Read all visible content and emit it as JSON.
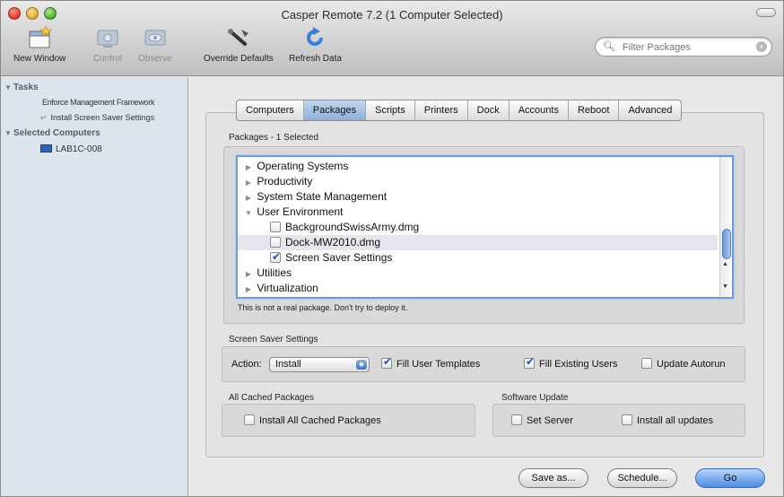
{
  "window": {
    "title": "Casper Remote 7.2  (1 Computer Selected)"
  },
  "toolbar": {
    "new_window": "New Window",
    "control": "Control",
    "observe": "Observe",
    "override_defaults": "Override Defaults",
    "refresh_data": "Refresh Data",
    "filter_placeholder": "Filter Packages"
  },
  "sidebar": {
    "tasks_heading": "Tasks",
    "tasks": [
      "Enforce Management Framework",
      "Install Screen Saver Settings"
    ],
    "computers_heading": "Selected Computers",
    "computers": [
      "LAB1C-008"
    ]
  },
  "tabs": [
    "Computers",
    "Packages",
    "Scripts",
    "Printers",
    "Dock",
    "Accounts",
    "Reboot",
    "Advanced"
  ],
  "packages": {
    "heading": "Packages - 1 Selected",
    "items": [
      "Operating Systems",
      "Productivity",
      "System State Management",
      "User Environment",
      "BackgroundSwissArmy.dmg",
      "Dock-MW2010.dmg",
      "Screen Saver Settings",
      "Utilities",
      "Virtualization"
    ],
    "note": "This is not a real package. Don't try to deploy it."
  },
  "screen_saver": {
    "heading": "Screen Saver Settings",
    "action_label": "Action:",
    "action_value": "Install",
    "fill_user_templates": "Fill User Templates",
    "fill_existing_users": "Fill Existing Users",
    "update_autorun": "Update Autorun"
  },
  "cached": {
    "heading": "All Cached Packages",
    "install_all": "Install All Cached Packages"
  },
  "software_update": {
    "heading": "Software Update",
    "set_server": "Set Server",
    "install_all_updates": "Install all updates"
  },
  "buttons": {
    "save_as": "Save as...",
    "schedule": "Schedule...",
    "go": "Go"
  },
  "colors": {
    "accent": "#4c8be0",
    "sidebar_bg": "#dde4ec",
    "selected_tab": "#a7c2e6"
  }
}
